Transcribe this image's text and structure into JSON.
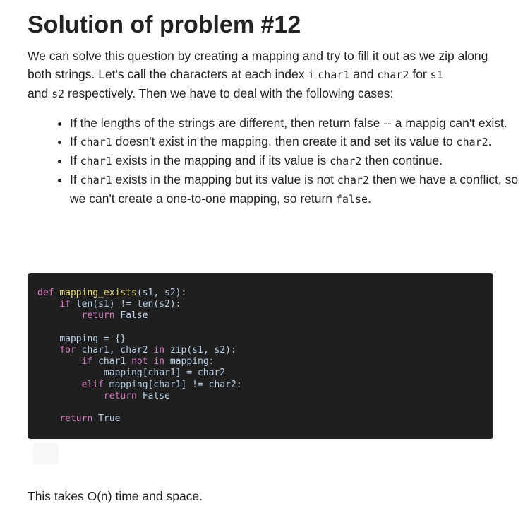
{
  "title": "Solution of problem #12",
  "intro": {
    "t1": "We can solve this question by creating a mapping and try to fill it out as we zip along both strings. Let's call the characters at each index ",
    "c1": "i",
    "t2": " ",
    "c2": "char1",
    "t3": " and ",
    "c3": "char2",
    "t4": " for ",
    "c4": "s1",
    "t5": " and ",
    "c5": "s2",
    "t6": " respectively. Then we have to deal with the following cases:"
  },
  "cases": [
    {
      "t1": "If the lengths of the strings are different, then return false -- a mappig can't exist."
    },
    {
      "t1": "If ",
      "c1": "char1",
      "t2": " doesn't exist in the mapping, then create it and set its value to ",
      "c2": "char2",
      "t3": "."
    },
    {
      "t1": "If ",
      "c1": "char1",
      "t2": " exists in the mapping and if its value is ",
      "c2": "char2",
      "t3": " then continue."
    },
    {
      "t1": "If ",
      "c1": "char1",
      "t2": " exists in the mapping but its value is not ",
      "c2": "char2",
      "t3": " then we have a conflict, so we can't create a one-to-one mapping, so return ",
      "c3": "false",
      "t4": "."
    }
  ],
  "code": {
    "l1_kw": "def",
    "l1_fn": "mapping_exists",
    "l1_rest": "(s1, s2):",
    "l2_kw": "if",
    "l2_rest": " len(s1) != len(s2):",
    "l3_kw": "return",
    "l3_rest": " False",
    "l5": "mapping = {}",
    "l6_kw": "for",
    "l6_a": " char1, char2 ",
    "l6_kw2": "in",
    "l6_b": " zip(s1, s2):",
    "l7_kw": "if",
    "l7_a": " char1 ",
    "l7_kw2": "not in",
    "l7_b": " mapping:",
    "l8": "mapping[char1] = char2",
    "l9_kw": "elif",
    "l9_rest": " mapping[char1] != char2:",
    "l10_kw": "return",
    "l10_rest": " False",
    "l12_kw": "return",
    "l12_rest": " True"
  },
  "outro": "This takes O(n) time and space."
}
